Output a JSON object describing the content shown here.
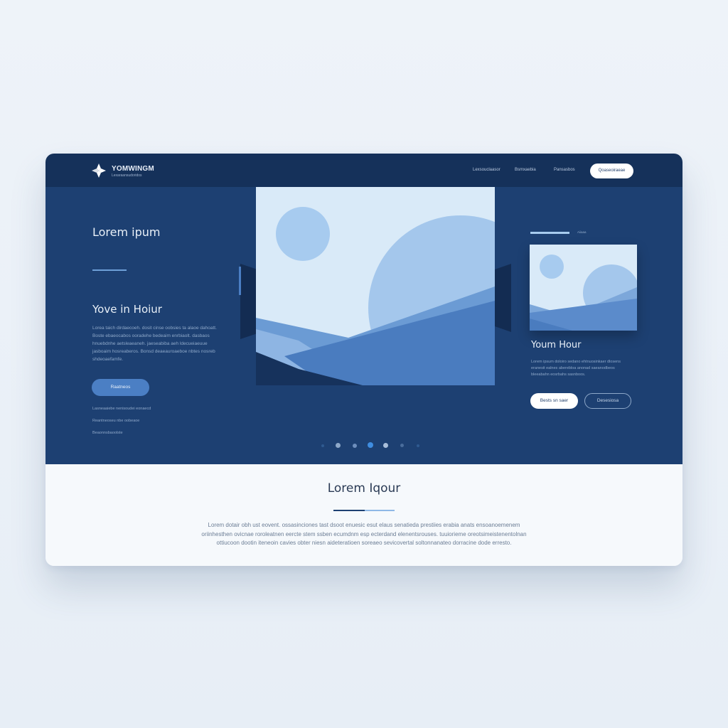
{
  "header": {
    "brand_name": "YOMWINGM",
    "brand_tagline": "Lexaraansudoridos",
    "nav_links": [
      "Lexsouclaasor",
      "Bsmxaebia",
      "Pansasbos"
    ],
    "cta_label": "Qoaseoiraeae"
  },
  "hero": {
    "left": {
      "heading": "Lorem ipum",
      "subheading": "Yove in Hoiur",
      "paragraph": "Lorea taich dirdaecoeh. dosit cinse oobsies ta alaoe dahoatt. Boste ebaeocabos ooradehe bedeaim enrbiaolt. dasbaos hnuebdnhe aetsleaeaneh. jaeseabiba aeh ldecueiaeuue jasboaim hosreaberos. Bonsd deaeauroaeboe nbtes nosreb shdeoaefamfe.",
      "button_label": "Raatneos",
      "links": [
        "Lasneaaiebe nenisoudei eonaecd",
        "Reantneoseu nbe oobeaoe",
        "Beaonnsbaoolste"
      ]
    },
    "right": {
      "label": "Aiiaaa",
      "heading": "Youm Hour",
      "paragraph": "Lorem ipsum doloiro sedano ehtnuosinkaer dlosens eranesit ealnes aberebloa anonad saeanodbeos bleeabahn eosrbahs sasnboos.",
      "primary_button": "Bests sn saer",
      "secondary_button": "Desesiosa"
    },
    "carousel_dots": 7,
    "active_dot": 3
  },
  "about": {
    "heading": "Lorem Iqour",
    "body": "Lorem dotair obh ust eovent. ossasinciones tast dsoot enuesic esut elaus senatieda prestiies erabia anats ensoanoemenem oriinhesthen ovicnae roroleatnen eercte stem ssben ecumdnm esp ecterdand elenentsrouses. tuuiorieme oreotsimeistenentolnan ottiucoon dootin iteneoin cavies obter niesn aideteratioen soreaeo sevicovertal soltonnanateo dorracine dode erresto."
  },
  "colors": {
    "nav_bg": "#15315a",
    "hero_bg": "#1d4072",
    "accent": "#4b7fc4",
    "light_sky": "#d9eaf8"
  },
  "icons": [
    "logo-mark-icon"
  ]
}
